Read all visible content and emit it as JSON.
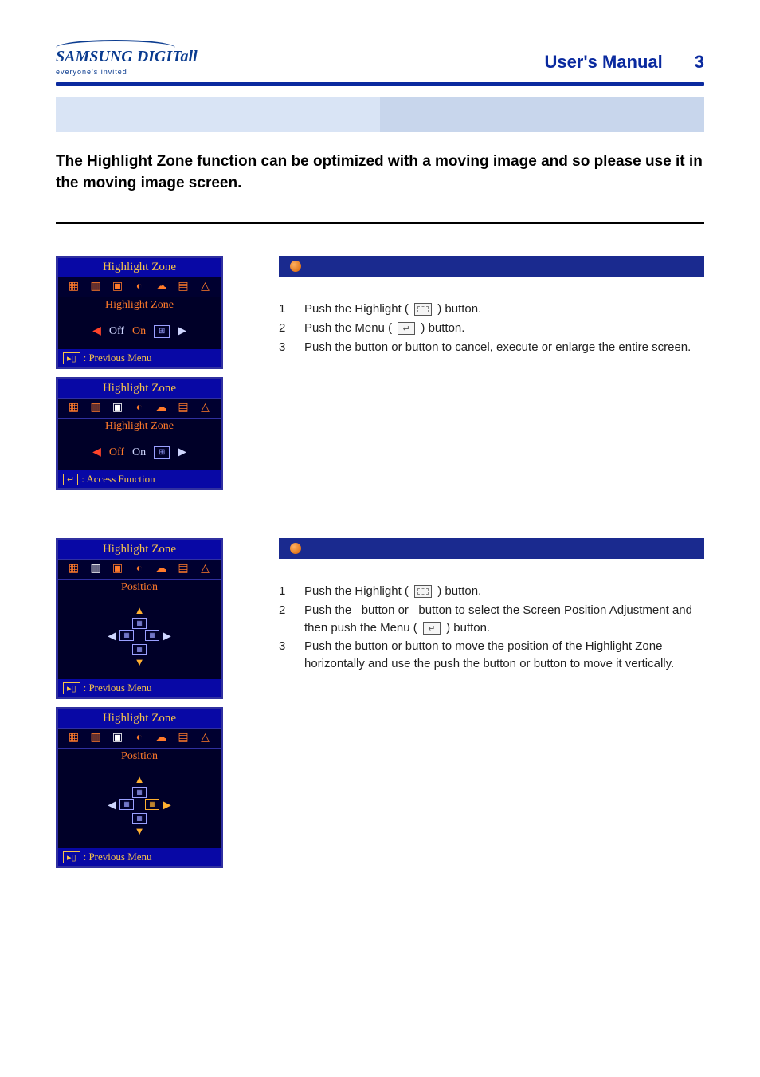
{
  "header": {
    "logo_main": "SAMSUNG DIGITall",
    "logo_sub": "everyone's invited",
    "manual_title": "User's Manual",
    "page_number": "3"
  },
  "intro_text": "The Highlight Zone function can be optimized with a moving image and so please use it in the moving image screen.",
  "sections": [
    {
      "id": "highlight-zone",
      "osd": {
        "title": "Highlight Zone",
        "subtitle": "Highlight Zone",
        "body_left": "Off",
        "body_right": "On",
        "foot_prev": ": Previous Menu",
        "foot_access": ": Access Function"
      },
      "steps": [
        {
          "n": "1",
          "t": "Push the Highlight (        ) button."
        },
        {
          "n": "2",
          "t": "Push the Menu (        ) button."
        },
        {
          "n": "3",
          "t": "Push the    button or    button to cancel, execute or enlarge the entire screen."
        }
      ]
    },
    {
      "id": "position",
      "osd": {
        "title": "Highlight Zone",
        "subtitle": "Position",
        "foot_prev": ": Previous Menu"
      },
      "steps": [
        {
          "n": "1",
          "t": "Push the Highlight (        ) button."
        },
        {
          "n": "2",
          "t": "Push the   button or   button to select the Screen Position Adjustment and then push the Menu (        ) button."
        },
        {
          "n": "3",
          "t": "Push the    button or    button to move the position of the Highlight Zone horizontally and use the push the    button or    button to move it vertically."
        }
      ]
    }
  ]
}
